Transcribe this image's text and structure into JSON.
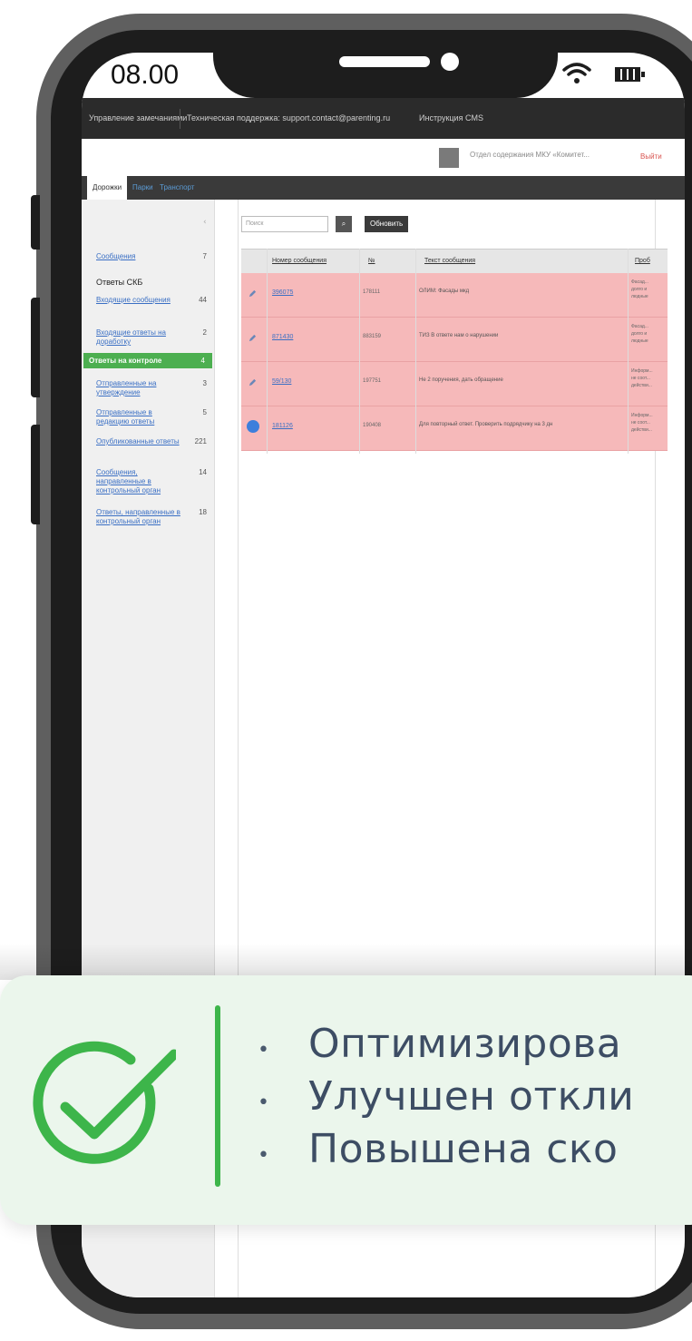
{
  "status_bar": {
    "time": "08.00"
  },
  "web_app": {
    "topbar": {
      "title": "Управление замечаниями",
      "support": "Техническая поддержка: support.contact@parenting.ru",
      "guide": "Инструкция CMS"
    },
    "user": {
      "name": "Отдел содержания МКУ «Комитет...",
      "logout": "Выйти"
    },
    "tabs": [
      {
        "label": "Дорожки"
      },
      {
        "label": "Парки"
      },
      {
        "label": "Транспорт"
      }
    ],
    "sidebar": {
      "heading": "Ответы СКБ",
      "items": [
        {
          "label": "Сообщения",
          "count": "7"
        },
        {
          "label": "Входящие сообщения",
          "count": "44"
        },
        {
          "label": "Входящие ответы на доработку",
          "count": "2"
        },
        {
          "label": "Ответы на контроле",
          "count": "4"
        },
        {
          "label": "Отправленные на утверждение",
          "count": "3"
        },
        {
          "label": "Отправленные в редакцию ответы",
          "count": "5"
        },
        {
          "label": "Опубликованные ответы",
          "count": "221"
        },
        {
          "label": "Сообщения, направленные в контрольный орган",
          "count": "14"
        },
        {
          "label": "Ответы, направленные в контрольный орган",
          "count": "18"
        }
      ]
    },
    "toolbar": {
      "search_placeholder": "Поиск",
      "refresh_label": "Обновить"
    },
    "table": {
      "headers": [
        "Номер сообщения",
        "№",
        "Текст сообщения",
        "Проб"
      ],
      "rows": [
        {
          "number": "396075",
          "code": "178111",
          "text": "ОЛИМ: Фасады мкд",
          "extra": "Фасад...\nдолго и\nлюдные",
          "icon": "edit"
        },
        {
          "number": "871430",
          "code": "883159",
          "text": "ТИЗ В ответе нам о нарушении",
          "extra": "Фасад...\nдолго и\nлюдные",
          "icon": "edit"
        },
        {
          "number": "59/130",
          "code": "197751",
          "text": "Не 2 поручения, дать обращение",
          "extra": "Информ...\nне соот...\nдействи...",
          "icon": "edit"
        },
        {
          "number": "181126",
          "code": "190408",
          "text": "Для повторный ответ. Проверить подрядчику на 3 дн",
          "extra": "Информ...\nне соот...\nдействи...",
          "icon": "check"
        }
      ]
    }
  },
  "notice": {
    "accent_color": "#3db54a",
    "items": [
      "Оптимизирова",
      "Улучшен откли",
      "Повышена ско"
    ]
  }
}
